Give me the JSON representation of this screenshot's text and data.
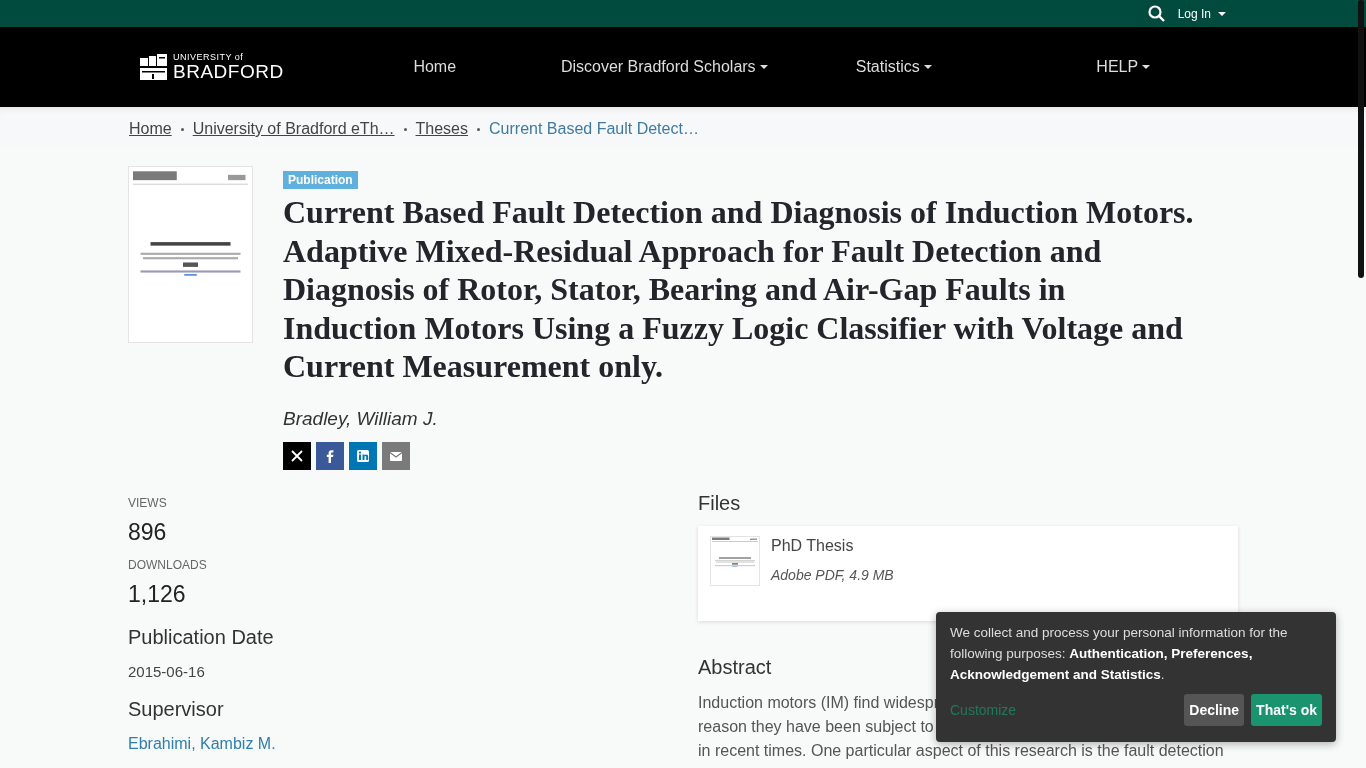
{
  "top_bar": {
    "login": "Log In"
  },
  "logo": {
    "line_1": "UNIVERSITY of",
    "line_2": "BRADFORD"
  },
  "navbar": {
    "items": [
      {
        "label": "Home",
        "dropdown": false
      },
      {
        "label": "Discover Bradford Scholars",
        "dropdown": true
      },
      {
        "label": "Statistics",
        "dropdown": true
      },
      {
        "label": "HELP",
        "dropdown": true
      }
    ]
  },
  "breadcrumbs": [
    {
      "label": "Home",
      "current": false
    },
    {
      "label": "University of Bradford eTh…",
      "current": false
    },
    {
      "label": "Theses",
      "current": false
    },
    {
      "label": "Current Based Fault Detect…",
      "current": true
    }
  ],
  "item": {
    "type_badge": "Publication",
    "title": "Current Based Fault Detection and Diagnosis of Induction Motors. Adaptive Mixed-Residual Approach for Fault Detection and Diagnosis of Rotor, Stator, Bearing and Air-Gap Faults in Induction Motors Using a Fuzzy Logic Classifier with Voltage and Current Measurement only.",
    "author": "Bradley, William J.",
    "share": [
      {
        "kind": "x"
      },
      {
        "kind": "facebook"
      },
      {
        "kind": "linkedin"
      },
      {
        "kind": "email"
      }
    ]
  },
  "stats": [
    {
      "label": "VIEWS",
      "value": "896"
    },
    {
      "label": "DOWNLOADS",
      "value": "1,126"
    }
  ],
  "fields": [
    {
      "heading": "Publication Date",
      "values": [
        {
          "text": "2015-06-16",
          "link": false
        }
      ]
    },
    {
      "heading": "Supervisor",
      "values": [
        {
          "text": "Ebrahimi, Kambiz M.",
          "link": true
        }
      ]
    }
  ],
  "files": {
    "heading": "Files",
    "items": [
      {
        "name": "PhD Thesis",
        "info": "Adobe PDF, 4.9 MB"
      }
    ]
  },
  "abstract": {
    "heading": "Abstract",
    "lines": [
      "Induction motors (IM) find widespr",
      "reason they have been subject to",
      "in recent times. One particular aspect of this research is the fault detection"
    ]
  },
  "cookie_banner": {
    "text": "We collect and process your personal information for the following purposes: **Authentication, Preferences, Acknowledgement and Statistics**.",
    "customize": "Customize",
    "buttons": [
      {
        "label": "Decline",
        "kind": "secondary"
      },
      {
        "label": "That's ok",
        "kind": "primary"
      }
    ]
  }
}
